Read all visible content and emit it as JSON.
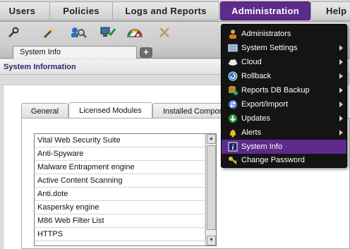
{
  "menubar": {
    "tabs": [
      {
        "label": "Users"
      },
      {
        "label": "Policies"
      },
      {
        "label": "Logs and Reports"
      },
      {
        "label": "Administration"
      },
      {
        "label": "Help"
      }
    ],
    "active_color": "#5e2a8c"
  },
  "toolbar": {
    "icons": [
      "wrench-icon",
      "wand-icon",
      "user-search-icon",
      "network-check-icon",
      "gauge-icon",
      "crossed-tools-icon"
    ]
  },
  "doc_tabs": {
    "active": "System Info",
    "add_symbol": "+"
  },
  "section": {
    "title": "System Information"
  },
  "inner_tabs": [
    {
      "label": "General"
    },
    {
      "label": "Licensed Modules"
    },
    {
      "label": "Installed Compon"
    }
  ],
  "licensed_modules": [
    "Vital Web Security Suite",
    "Anti-Spyware",
    "Malware Entrapment engine",
    "Active Content Scanning",
    "Anti.dote",
    "Kaspersky engine",
    "M86 Web Filter List",
    "HTTPS"
  ],
  "admin_menu": {
    "items": [
      {
        "label": "Administrators",
        "icon": "user-icon",
        "submenu": false
      },
      {
        "label": "System Settings",
        "icon": "settings-list-icon",
        "submenu": true
      },
      {
        "label": "Cloud",
        "icon": "cloud-icon",
        "submenu": true
      },
      {
        "label": "Rollback",
        "icon": "rollback-icon",
        "submenu": true
      },
      {
        "label": "Reports DB Backup",
        "icon": "database-icon",
        "submenu": true
      },
      {
        "label": "Export/Import",
        "icon": "export-import-icon",
        "submenu": true
      },
      {
        "label": "Updates",
        "icon": "updates-icon",
        "submenu": true
      },
      {
        "label": "Alerts",
        "icon": "bell-icon",
        "submenu": true
      },
      {
        "label": "System Info",
        "icon": "info-icon",
        "submenu": false,
        "selected": true
      },
      {
        "label": "Change Password",
        "icon": "keys-icon",
        "submenu": false
      }
    ],
    "selected_color": "#5e2a8c"
  }
}
